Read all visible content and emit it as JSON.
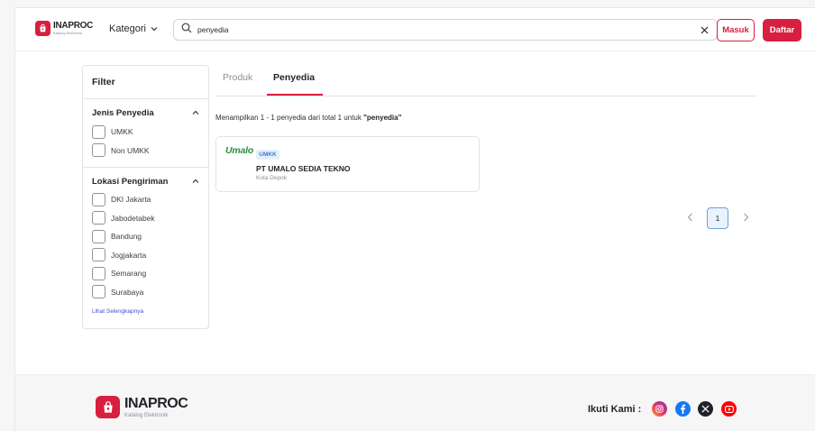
{
  "header": {
    "logo_title": "INAPROC",
    "logo_subtitle": "Katalog Elektronik",
    "category_label": "Kategori",
    "search_value": "penyedia",
    "login_label": "Masuk",
    "register_label": "Daftar"
  },
  "filter": {
    "title": "Filter",
    "provider_type": {
      "title": "Jenis Penyedia",
      "options": [
        "UMKK",
        "Non UMKK"
      ]
    },
    "shipping_location": {
      "title": "Lokasi Pengiriman",
      "options": [
        "DKI Jakarta",
        "Jabodetabek",
        "Bandung",
        "Jogjakarta",
        "Semarang",
        "Surabaya"
      ],
      "see_more": "Lihat Selengkapnya"
    }
  },
  "tabs": [
    {
      "label": "Produk",
      "active": false
    },
    {
      "label": "Penyedia",
      "active": true
    }
  ],
  "results": {
    "summary_prefix": "Menampilkan 1 - 1 penyedia dari total 1 untuk ",
    "summary_query": "\"penyedia\"",
    "cards": [
      {
        "logo_text": "Umalo",
        "badge": "UMKK",
        "name": "PT UMALO SEDIA TEKNO",
        "city": "Kota Depok"
      }
    ]
  },
  "pagination": {
    "current_page": "1"
  },
  "footer": {
    "logo_title": "INAPROC",
    "logo_subtitle": "Katalog Elektronik",
    "follow_label": "Ikuti Kami :",
    "social_icons": [
      "instagram-icon",
      "facebook-icon",
      "x-icon",
      "youtube-icon"
    ]
  },
  "colors": {
    "brand": "#d71f3f",
    "link": "#3a55c9",
    "badge_bg": "#e6f0fb",
    "badge_text": "#3f7bd3",
    "pager_active_border": "#6da0e0"
  }
}
